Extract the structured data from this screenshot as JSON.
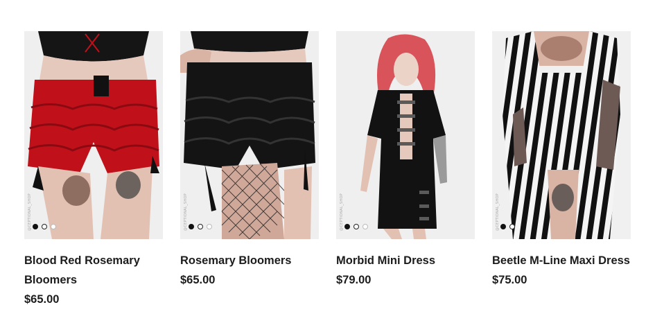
{
  "products": [
    {
      "name": "Blood Red Rosemary Bloomers",
      "price": "$65.00",
      "watermark": "@CEPTIONAL_SHOP",
      "image_colors": {
        "garment": "#c0111b",
        "top": "#151515"
      }
    },
    {
      "name": "Rosemary Bloomers",
      "price": "$65.00",
      "watermark": "@CEPTIONAL_SHOP",
      "image_colors": {
        "garment": "#141414",
        "top": "#151515"
      }
    },
    {
      "name": "Morbid Mini Dress",
      "price": "$79.00",
      "watermark": "@CEPTIONAL_SHOP",
      "image_colors": {
        "garment": "#121212",
        "hair": "#d9545a"
      }
    },
    {
      "name": "Beetle M-Line Maxi Dress",
      "price": "$75.00",
      "watermark": "@CEPTIONAL_SHOP",
      "image_colors": {
        "garment": "#111111",
        "stripe": "#f4f4f4"
      }
    }
  ],
  "carousel_dots": {
    "count": 3,
    "active_index": 0
  }
}
